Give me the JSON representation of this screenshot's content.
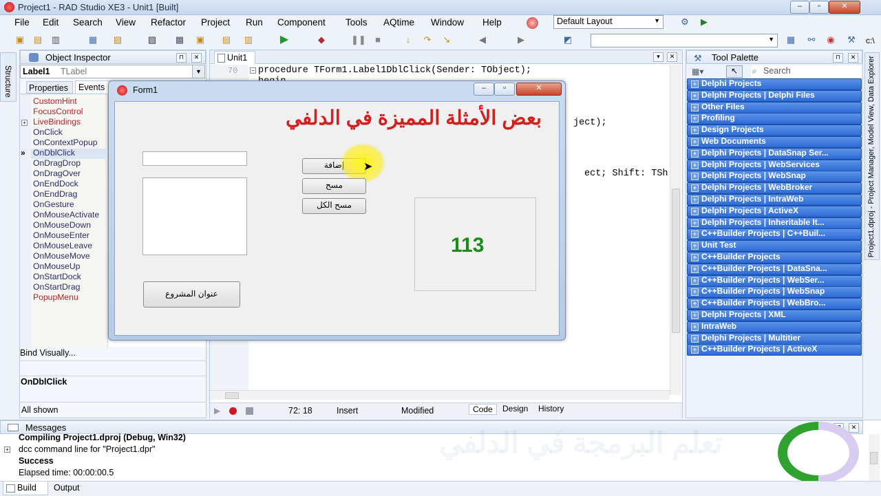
{
  "window": {
    "title": "Project1 - RAD Studio XE3 - Unit1 [Built]"
  },
  "menu": [
    "File",
    "Edit",
    "Search",
    "View",
    "Refactor",
    "Project",
    "Run",
    "Component",
    "Tools",
    "AQtime",
    "Window",
    "Help"
  ],
  "layout_combo": {
    "value": "Default Layout"
  },
  "side_tabs": {
    "left": "Structure",
    "right": "Project1.dproj - Project Manager, Model View, Data Explorer"
  },
  "object_inspector": {
    "title": "Object Inspector",
    "selected": {
      "name": "Label1",
      "type": "TLabel"
    },
    "tabs": [
      "Properties",
      "Events"
    ],
    "events": [
      {
        "label": "CustomHint",
        "red": true
      },
      {
        "label": "FocusControl",
        "red": true
      },
      {
        "label": "LiveBindings",
        "red": true,
        "expand": true
      },
      {
        "label": "OnClick",
        "red": false
      },
      {
        "label": "OnContextPopup",
        "red": false
      },
      {
        "label": "OnDblClick",
        "red": false,
        "current": true
      },
      {
        "label": "OnDragDrop",
        "red": false
      },
      {
        "label": "OnDragOver",
        "red": false
      },
      {
        "label": "OnEndDock",
        "red": false
      },
      {
        "label": "OnEndDrag",
        "red": false
      },
      {
        "label": "OnGesture",
        "red": false
      },
      {
        "label": "OnMouseActivate",
        "red": false
      },
      {
        "label": "OnMouseDown",
        "red": false
      },
      {
        "label": "OnMouseEnter",
        "red": false
      },
      {
        "label": "OnMouseLeave",
        "red": false
      },
      {
        "label": "OnMouseMove",
        "red": false
      },
      {
        "label": "OnMouseUp",
        "red": false
      },
      {
        "label": "OnStartDock",
        "red": false
      },
      {
        "label": "OnStartDrag",
        "red": false
      },
      {
        "label": "PopupMenu",
        "red": true
      }
    ],
    "bind_visually": "Bind Visually...",
    "event_name": "OnDblClick",
    "status": "All shown"
  },
  "editor": {
    "tab": "Unit1",
    "line_number": "70",
    "lines": [
      "procedure TForm1.Label1DblClick(Sender: TObject);",
      "begin"
    ],
    "fragment1": "ject);",
    "fragment2": "ect; Shift: TSh",
    "status": {
      "position": "72: 18",
      "mode": "Insert",
      "state": "Modified"
    },
    "bottom_tabs": [
      "Code",
      "Design",
      "History"
    ]
  },
  "form": {
    "title": "Form1",
    "heading": "بعض الأمثلة المميزة في الدلفي",
    "buttons": {
      "add": "إضافة",
      "clear": "مسح",
      "clear_all": "مسح الكل",
      "project_title": "عنوان المشروع"
    },
    "counter": "113"
  },
  "tool_palette": {
    "title": "Tool Palette",
    "search": "Search",
    "categories": [
      "Delphi Projects",
      "Delphi Projects | Delphi Files",
      "Other Files",
      "Profiling",
      "Design Projects",
      "Web Documents",
      "Delphi Projects | DataSnap Ser...",
      "Delphi Projects | WebServices",
      "Delphi Projects | WebSnap",
      "Delphi Projects | WebBroker",
      "Delphi Projects | IntraWeb",
      "Delphi Projects | ActiveX",
      "Delphi Projects | Inheritable It...",
      "C++Builder Projects | C++Buil...",
      "Unit Test",
      "C++Builder Projects",
      "C++Builder Projects | DataSna...",
      "C++Builder Projects | WebSer...",
      "C++Builder Projects | WebSnap",
      "C++Builder Projects | WebBro...",
      "Delphi Projects | XML",
      "IntraWeb",
      "Delphi Projects | Multitier",
      "C++Builder Projects | ActiveX"
    ]
  },
  "messages": {
    "title": "Messages",
    "lines": [
      {
        "text": "Compiling Project1.dproj (Debug, Win32)",
        "bold": true
      },
      {
        "text": "dcc command line for \"Project1.dpr\"",
        "bold": false
      },
      {
        "text": "Success",
        "bold": true
      },
      {
        "text": "Elapsed time: 00:00:00.5",
        "bold": false
      }
    ],
    "tabs": [
      "Build",
      "Output"
    ]
  },
  "watermark": "تعلم البرمجة في الدلفي",
  "path_combo": "c:\\"
}
